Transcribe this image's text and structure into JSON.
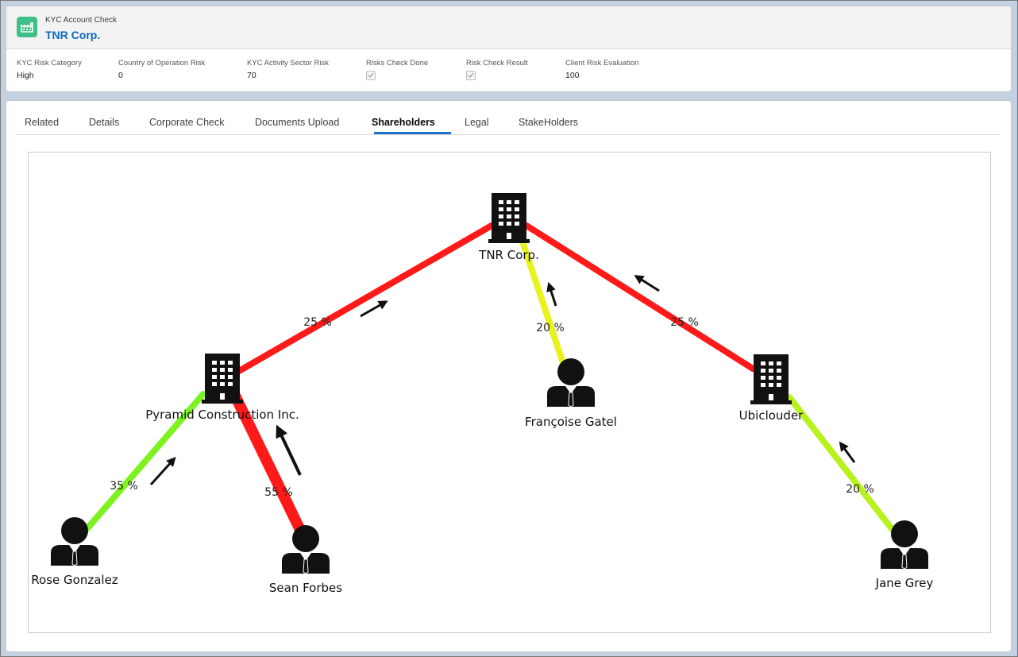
{
  "header": {
    "eyebrow": "KYC Account Check",
    "title": "TNR Corp.",
    "icon": "factory-icon",
    "icon_color": "#3fbf88"
  },
  "fields": [
    {
      "label": "KYC Risk Category",
      "value": "High"
    },
    {
      "label": "Country of Operation Risk",
      "value": "0"
    },
    {
      "label": "KYC Activity Sector Risk",
      "value": "70"
    },
    {
      "label": "Risks Check Done",
      "checked": true
    },
    {
      "label": "Risk Check Result",
      "checked": true
    },
    {
      "label": "Client Risk Evaluation",
      "value": "100"
    }
  ],
  "tabs": [
    {
      "label": "Related"
    },
    {
      "label": "Details"
    },
    {
      "label": "Corporate Check"
    },
    {
      "label": "Documents Upload"
    },
    {
      "label": "Shareholders",
      "active": true
    },
    {
      "label": "Legal"
    },
    {
      "label": "StakeHolders"
    }
  ],
  "graph": {
    "nodes": [
      {
        "id": "tnr",
        "label": "TNR Corp.",
        "kind": "company",
        "icon": "building-icon"
      },
      {
        "id": "pyramid",
        "label": "Pyramid Construction Inc.",
        "kind": "company",
        "icon": "building-icon"
      },
      {
        "id": "francoise",
        "label": "Françoise Gatel",
        "kind": "person",
        "icon": "person-icon"
      },
      {
        "id": "ubicloud",
        "label": "Ubiclouder",
        "kind": "company",
        "icon": "building-icon"
      },
      {
        "id": "rose",
        "label": "Rose Gonzalez",
        "kind": "person",
        "icon": "person-icon"
      },
      {
        "id": "sean",
        "label": "Sean Forbes",
        "kind": "person",
        "icon": "person-icon"
      },
      {
        "id": "jane",
        "label": "Jane Grey",
        "kind": "person",
        "icon": "person-icon"
      }
    ],
    "edges": [
      {
        "from": "pyramid",
        "to": "tnr",
        "label": "25 %",
        "color": "#ff1a1a"
      },
      {
        "from": "francoise",
        "to": "tnr",
        "label": "20 %",
        "color": "#e8f21e"
      },
      {
        "from": "ubicloud",
        "to": "tnr",
        "label": "25 %",
        "color": "#ff1a1a"
      },
      {
        "from": "rose",
        "to": "pyramid",
        "label": "35 %",
        "color": "#7cf21e"
      },
      {
        "from": "sean",
        "to": "pyramid",
        "label": "55 %",
        "color": "#ff1a1a"
      },
      {
        "from": "jane",
        "to": "ubicloud",
        "label": "20 %",
        "color": "#b8f21e"
      }
    ]
  }
}
